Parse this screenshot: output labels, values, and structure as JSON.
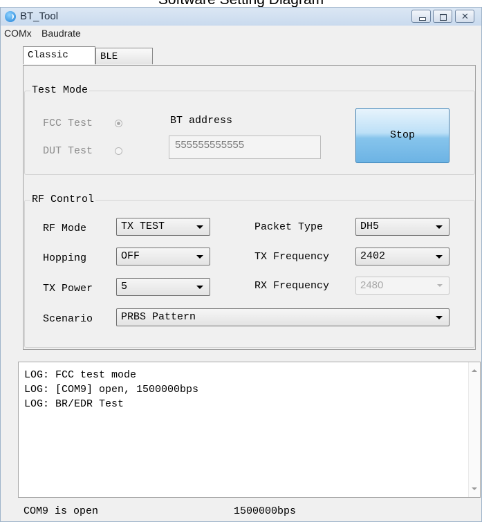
{
  "caption": "Software Setting Diagram",
  "window": {
    "title": "BT_Tool"
  },
  "menu": [
    "COMx",
    "Baudrate"
  ],
  "tabs": [
    "Classic",
    "BLE"
  ],
  "test_mode": {
    "title": "Test Mode",
    "fcc_label": "FCC Test",
    "dut_label": "DUT Test",
    "bt_address_label": "BT address",
    "bt_address_value": "555555555555",
    "stop_label": "Stop"
  },
  "rf_control": {
    "title": "RF Control",
    "rf_mode_label": "RF Mode",
    "rf_mode_value": "TX TEST",
    "hopping_label": "Hopping",
    "hopping_value": "OFF",
    "tx_power_label": "TX Power",
    "tx_power_value": "5",
    "scenario_label": "Scenario",
    "scenario_value": "PRBS Pattern",
    "packet_type_label": "Packet Type",
    "packet_type_value": "DH5",
    "tx_frequency_label": "TX Frequency",
    "tx_frequency_value": "2402",
    "rx_frequency_label": "RX Frequency",
    "rx_frequency_value": "2480"
  },
  "log": [
    "LOG: FCC test mode",
    "LOG: [COM9] open, 1500000bps",
    "LOG: BR/EDR Test"
  ],
  "status": {
    "port": "COM9 is open",
    "baud": "1500000bps"
  }
}
